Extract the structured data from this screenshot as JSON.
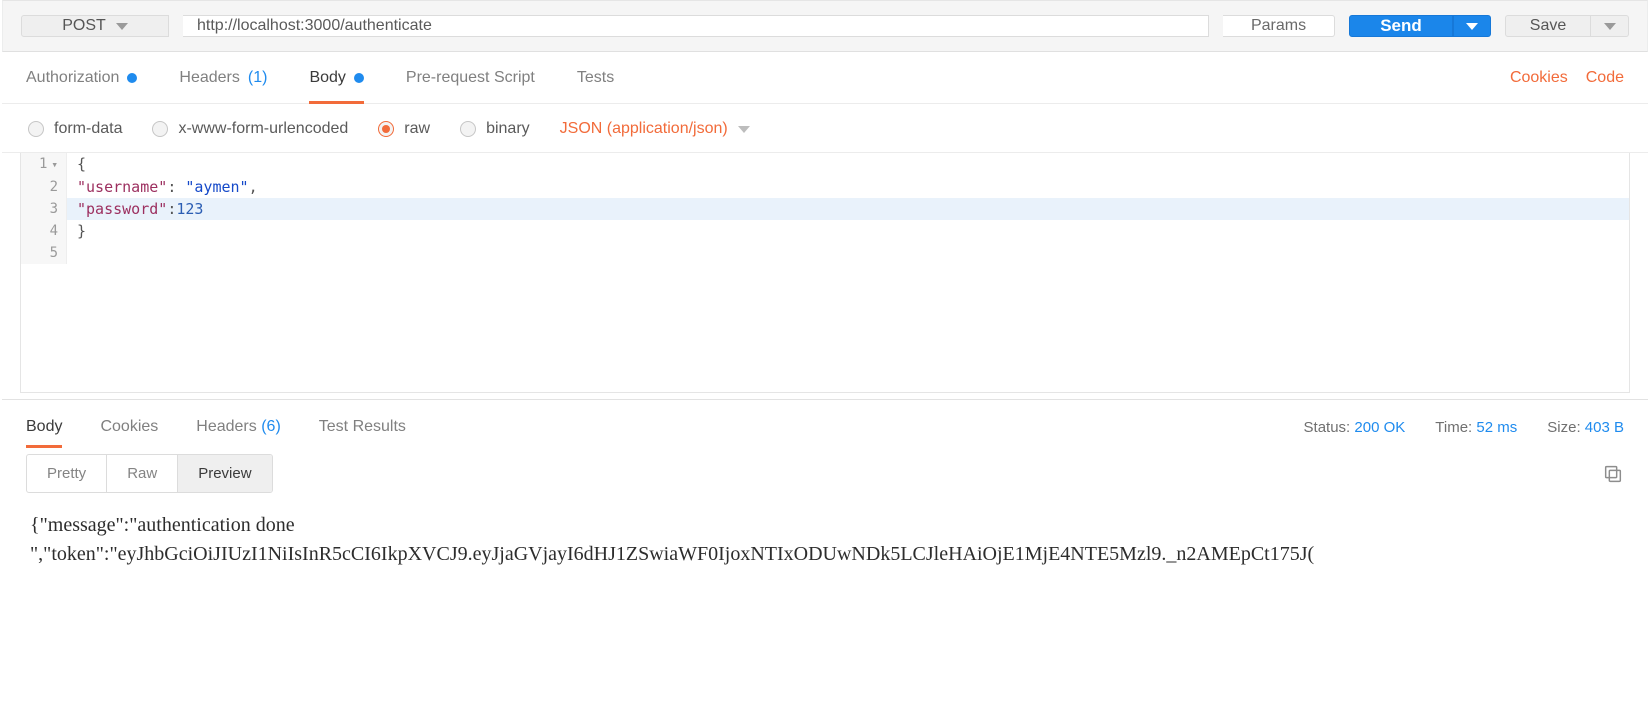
{
  "request": {
    "method": "POST",
    "url": "http://localhost:3000/authenticate",
    "params_label": "Params",
    "send_label": "Send",
    "save_label": "Save"
  },
  "req_tabs": {
    "authorization": "Authorization",
    "headers_label": "Headers",
    "headers_count": "(1)",
    "body": "Body",
    "prerequest": "Pre-request Script",
    "tests": "Tests",
    "cookies": "Cookies",
    "code": "Code"
  },
  "body_types": {
    "form_data": "form-data",
    "urlencoded": "x-www-form-urlencoded",
    "raw": "raw",
    "binary": "binary",
    "content_type": "JSON (application/json)"
  },
  "editor": {
    "lines": {
      "l1_num": "1",
      "l1_code_brace": "{",
      "l2_num": "2",
      "l2_key": "\"username\"",
      "l2_sep": ": ",
      "l2_val": "\"aymen\"",
      "l2_end": ",",
      "l3_num": "3",
      "l3_key": "\"password\"",
      "l3_sep": ":",
      "l3_val": "123",
      "l4_num": "4",
      "l4_code_brace": "}",
      "l5_num": "5"
    }
  },
  "response": {
    "tabs": {
      "body": "Body",
      "cookies": "Cookies",
      "headers_label": "Headers",
      "headers_count": "(6)",
      "test_results": "Test Results"
    },
    "meta": {
      "status_label": "Status:",
      "status_value": "200 OK",
      "time_label": "Time:",
      "time_value": "52 ms",
      "size_label": "Size:",
      "size_value": "403 B"
    },
    "subtabs": {
      "pretty": "Pretty",
      "raw": "Raw",
      "preview": "Preview"
    },
    "body_text": "{\"message\":\"authentication done\n\",\"token\":\"eyJhbGciOiJIUzI1NiIsInR5cCI6IkpXVCJ9.eyJjaGVjayI6dHJ1ZSwiaWF0IjoxNTIxODUwNDk5LCJleHAiOjE1MjE4NTE5Mzl9._n2AMEpCt175J("
  }
}
